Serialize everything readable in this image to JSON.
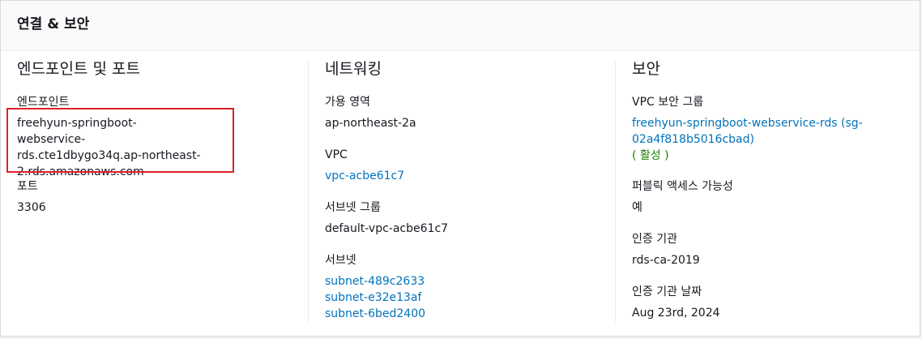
{
  "panel": {
    "title": "연결 & 보안"
  },
  "endpoint_section": {
    "title": "엔드포인트 및 포트",
    "endpoint_label": "엔드포인트",
    "endpoint_lines": [
      "freehyun-springboot-webservice-",
      "rds.cte1dbygo34q.ap-northeast-",
      "2.rds.amazonaws.com"
    ],
    "port_label": "포트",
    "port_value": "3306"
  },
  "network_section": {
    "title": "네트워킹",
    "az_label": "가용 영역",
    "az_value": "ap-northeast-2a",
    "vpc_label": "VPC",
    "vpc_value": "vpc-acbe61c7",
    "subnet_group_label": "서브넷 그룹",
    "subnet_group_value": "default-vpc-acbe61c7",
    "subnets_label": "서브넷",
    "subnets": [
      "subnet-489c2633",
      "subnet-e32e13af",
      "subnet-6bed2400"
    ]
  },
  "security_section": {
    "title": "보안",
    "sg_label": "VPC 보안 그룹",
    "sg_link_lines": [
      "freehyun-springboot-webservice-rds (sg-",
      "02a4f818b5016cbad)"
    ],
    "sg_status": "( 활성 )",
    "public_label": "퍼블릭 액세스 가능성",
    "public_value": "예",
    "ca_label": "인증 기관",
    "ca_value": "rds-ca-2019",
    "ca_date_label": "인증 기관 날짜",
    "ca_date_value": "Aug 23rd, 2024"
  },
  "colors": {
    "link": "#0073bb",
    "status_active": "#1d8102",
    "highlight": "#e0202a"
  }
}
